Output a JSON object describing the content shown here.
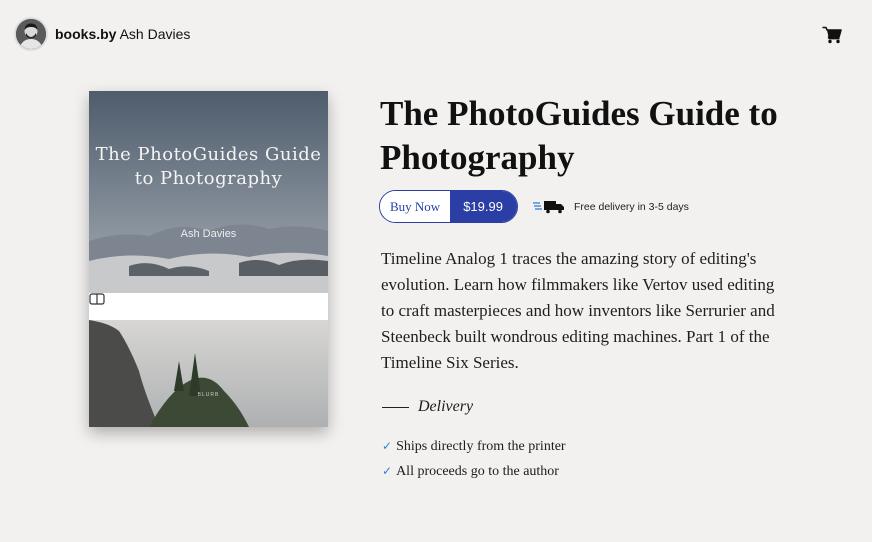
{
  "header": {
    "brand_bold": "books.by",
    "brand_name": "Ash Davies",
    "avatar_icon": "user-avatar",
    "cart_icon": "cart-icon"
  },
  "book": {
    "cover_title": "The PhotoGuides Guide to Photography",
    "cover_author": "Ash Davies",
    "cover_band_icon": "book-open-icon",
    "cover_mark": "BLURB",
    "title": "The PhotoGuides Guide to Photography",
    "buy_label": "Buy Now",
    "price": "$19.99",
    "delivery_note": "Free delivery in 3-5 days",
    "description": "Timeline Analog 1 traces the amazing story of editing's evolution. Learn how filmmakers like Vertov used editing to craft masterpieces and how inventors like Serrurier and Steenbeck built wondrous editing machines. Part 1 of the Timeline Six Series."
  },
  "delivery": {
    "heading": "Delivery",
    "items": [
      "Ships directly from the printer",
      "All proceeds go to the author"
    ]
  },
  "colors": {
    "accent": "#2a3ea5",
    "background": "#f2f1ef",
    "tick": "#2f7fd8"
  }
}
